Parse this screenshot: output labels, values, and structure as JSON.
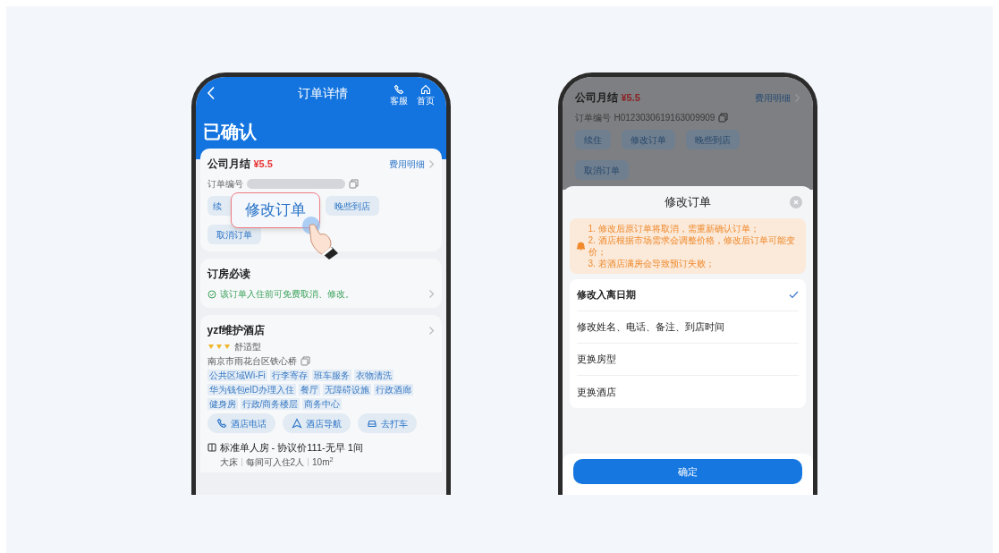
{
  "left_phone": {
    "nav": {
      "title": "订单详情",
      "actions": [
        {
          "kind": "phone",
          "label": "客服"
        },
        {
          "kind": "home",
          "label": "首页"
        }
      ]
    },
    "status_title": "已确认",
    "order_card": {
      "payment": "公司月结",
      "price": "¥5.5",
      "fee_link": "费用明细",
      "order_no_label": "订单编号",
      "buttons": [
        "续",
        "晚些到店",
        "取消订单"
      ],
      "callout": "修改订单"
    },
    "notice_card": {
      "title": "订房必读",
      "text": "该订单入住前可免费取消、修改。"
    },
    "hotel_card": {
      "name": "yzf维护酒店",
      "stars": 3,
      "type": "舒适型",
      "address": "南京市雨花台区铁心桥",
      "tags": [
        "公共区域Wi-Fi",
        "行李寄存",
        "班车服务",
        "衣物清洗",
        "华为钱包eID办理入住",
        "餐厅",
        "无障碍设施",
        "行政酒廊",
        "健身房",
        "行政/商务楼层",
        "商务中心"
      ],
      "actions": [
        {
          "kind": "phone",
          "label": "酒店电话"
        },
        {
          "kind": "nav",
          "label": "酒店导航"
        },
        {
          "kind": "car",
          "label": "去打车"
        }
      ]
    },
    "room": {
      "title": "标准单人房 - 协议价111-无早 1间",
      "specs": [
        "大床",
        "每间可入住2人",
        "10m$^{2}$"
      ]
    }
  },
  "right_phone": {
    "order_card": {
      "payment": "公司月结",
      "price": "¥5.5",
      "fee_link": "费用明细",
      "order_no_label": "订单编号",
      "order_no": "H0123030619163009909",
      "buttons": [
        "续住",
        "修改订单",
        "晚些到店",
        "取消订单"
      ]
    },
    "sheet": {
      "title": "修改订单",
      "notices": [
        "1. 修改后原订单将取消，需重新确认订单；",
        "2. 酒店根据市场需求会调整价格，修改后订单可能变价；",
        "3. 若酒店满房会导致预订失败；"
      ],
      "options": [
        {
          "label": "修改入离日期",
          "selected": true
        },
        {
          "label": "修改姓名、电话、备注、到店时间",
          "selected": false
        },
        {
          "label": "更换房型",
          "selected": false
        },
        {
          "label": "更换酒店",
          "selected": false
        }
      ],
      "confirm": "确定"
    }
  }
}
